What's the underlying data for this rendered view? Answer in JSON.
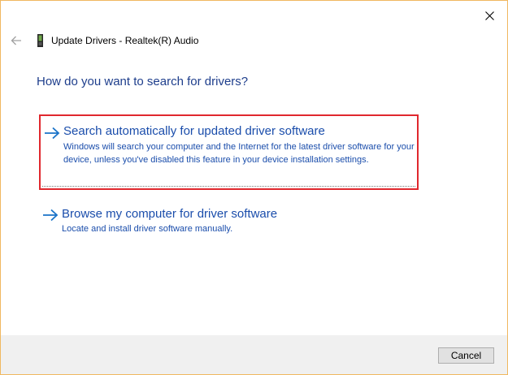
{
  "window": {
    "title": "Update Drivers - Realtek(R) Audio",
    "close_icon": "close-icon",
    "back_icon": "back-arrow-icon",
    "device_icon": "audio-device-icon",
    "border_color": "#f0b860"
  },
  "main": {
    "heading": "How do you want to search for drivers?",
    "options": [
      {
        "title": "Search automatically for updated driver software",
        "description": "Windows will search your computer and the Internet for the latest driver software for your device, unless you've disabled this feature in your device installation settings.",
        "icon": "right-arrow-icon",
        "highlighted": true,
        "highlight_color": "#e0282e"
      },
      {
        "title": "Browse my computer for driver software",
        "description": "Locate and install driver software manually.",
        "icon": "right-arrow-icon",
        "highlighted": false
      }
    ],
    "link_color": "#1a4dab",
    "heading_color": "#1e3e8c"
  },
  "footer": {
    "cancel_label": "Cancel"
  }
}
